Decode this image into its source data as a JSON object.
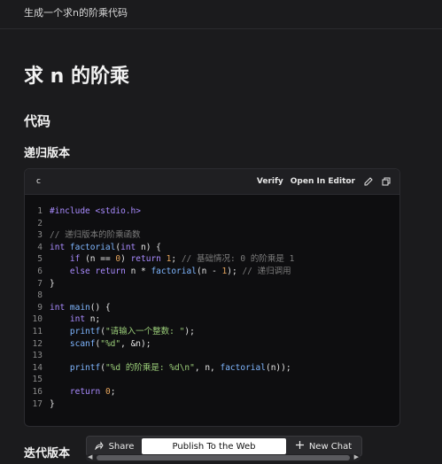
{
  "prompt": "生成一个求n的阶乘代码",
  "title": "求 n 的阶乘",
  "section_code": "代码",
  "section_recursive": "递归版本",
  "section_iterative": "迭代版本",
  "code_block": {
    "language": "c",
    "verify_label": "Verify",
    "open_label": "Open In Editor",
    "lines": [
      {
        "n": "1",
        "segs": [
          {
            "t": "#include <stdio.h>",
            "c": "kw"
          }
        ]
      },
      {
        "n": "2",
        "segs": [
          {
            "t": "",
            "c": "tx"
          }
        ]
      },
      {
        "n": "3",
        "segs": [
          {
            "t": "// 递归版本的阶乘函数",
            "c": "cm"
          }
        ]
      },
      {
        "n": "4",
        "segs": [
          {
            "t": "int ",
            "c": "kw"
          },
          {
            "t": "factorial",
            "c": "fn"
          },
          {
            "t": "(",
            "c": "tx"
          },
          {
            "t": "int",
            "c": "kw"
          },
          {
            "t": " n) {",
            "c": "tx"
          }
        ]
      },
      {
        "n": "5",
        "segs": [
          {
            "t": "    ",
            "c": "tx"
          },
          {
            "t": "if",
            "c": "kw"
          },
          {
            "t": " (n == ",
            "c": "tx"
          },
          {
            "t": "0",
            "c": "num"
          },
          {
            "t": ") ",
            "c": "tx"
          },
          {
            "t": "return",
            "c": "kw"
          },
          {
            "t": " ",
            "c": "tx"
          },
          {
            "t": "1",
            "c": "num"
          },
          {
            "t": "; ",
            "c": "tx"
          },
          {
            "t": "// 基础情况: 0 的阶乘是 1",
            "c": "cm"
          }
        ]
      },
      {
        "n": "6",
        "segs": [
          {
            "t": "    ",
            "c": "tx"
          },
          {
            "t": "else",
            "c": "kw"
          },
          {
            "t": " ",
            "c": "tx"
          },
          {
            "t": "return",
            "c": "kw"
          },
          {
            "t": " n * ",
            "c": "tx"
          },
          {
            "t": "factorial",
            "c": "fn"
          },
          {
            "t": "(n - ",
            "c": "tx"
          },
          {
            "t": "1",
            "c": "num"
          },
          {
            "t": "); ",
            "c": "tx"
          },
          {
            "t": "// 递归调用",
            "c": "cm"
          }
        ]
      },
      {
        "n": "7",
        "segs": [
          {
            "t": "}",
            "c": "tx"
          }
        ]
      },
      {
        "n": "8",
        "segs": [
          {
            "t": "",
            "c": "tx"
          }
        ]
      },
      {
        "n": "9",
        "segs": [
          {
            "t": "int ",
            "c": "kw"
          },
          {
            "t": "main",
            "c": "fn"
          },
          {
            "t": "() {",
            "c": "tx"
          }
        ]
      },
      {
        "n": "10",
        "segs": [
          {
            "t": "    ",
            "c": "tx"
          },
          {
            "t": "int",
            "c": "kw"
          },
          {
            "t": " n;",
            "c": "tx"
          }
        ]
      },
      {
        "n": "11",
        "segs": [
          {
            "t": "    ",
            "c": "tx"
          },
          {
            "t": "printf",
            "c": "fn"
          },
          {
            "t": "(",
            "c": "tx"
          },
          {
            "t": "\"请输入一个整数: \"",
            "c": "str"
          },
          {
            "t": ");",
            "c": "tx"
          }
        ]
      },
      {
        "n": "12",
        "segs": [
          {
            "t": "    ",
            "c": "tx"
          },
          {
            "t": "scanf",
            "c": "fn"
          },
          {
            "t": "(",
            "c": "tx"
          },
          {
            "t": "\"%d\"",
            "c": "str"
          },
          {
            "t": ", &n);",
            "c": "tx"
          }
        ]
      },
      {
        "n": "13",
        "segs": [
          {
            "t": "",
            "c": "tx"
          }
        ]
      },
      {
        "n": "14",
        "segs": [
          {
            "t": "    ",
            "c": "tx"
          },
          {
            "t": "printf",
            "c": "fn"
          },
          {
            "t": "(",
            "c": "tx"
          },
          {
            "t": "\"%d 的阶乘是: %d\\n\"",
            "c": "str"
          },
          {
            "t": ", n, ",
            "c": "tx"
          },
          {
            "t": "factorial",
            "c": "fn"
          },
          {
            "t": "(n));",
            "c": "tx"
          }
        ]
      },
      {
        "n": "15",
        "segs": [
          {
            "t": "",
            "c": "tx"
          }
        ]
      },
      {
        "n": "16",
        "segs": [
          {
            "t": "    ",
            "c": "tx"
          },
          {
            "t": "return",
            "c": "kw"
          },
          {
            "t": " ",
            "c": "tx"
          },
          {
            "t": "0",
            "c": "num"
          },
          {
            "t": ";",
            "c": "tx"
          }
        ]
      },
      {
        "n": "17",
        "segs": [
          {
            "t": "}",
            "c": "tx"
          }
        ]
      }
    ]
  },
  "bottom_bar": {
    "share_label": "Share",
    "publish_label": "Publish To the Web",
    "new_chat_label": "New Chat"
  },
  "icons": {
    "edit": "pencil-icon",
    "copy": "copy-icon",
    "share": "share-icon",
    "new_chat": "plus-icon"
  }
}
